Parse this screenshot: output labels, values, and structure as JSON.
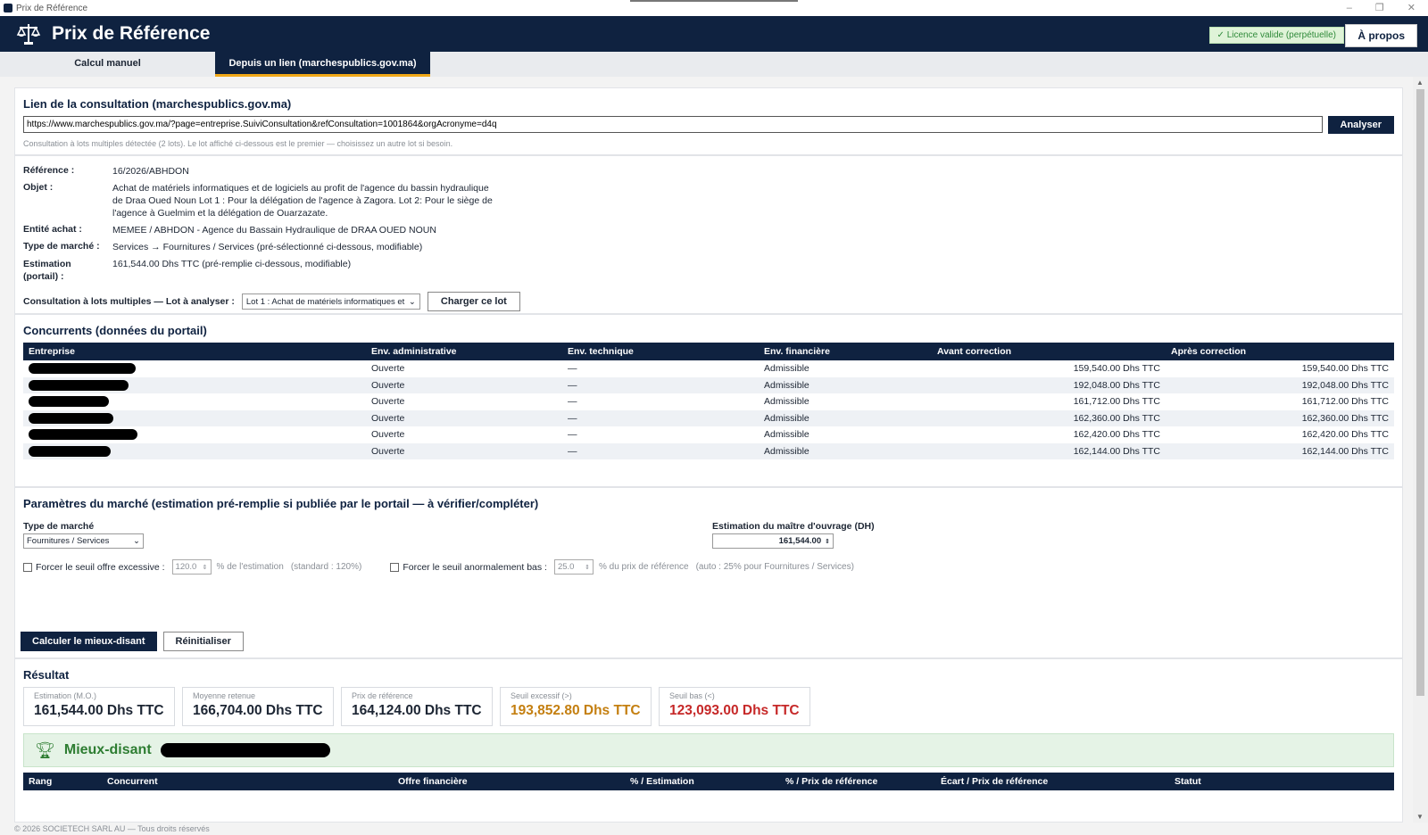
{
  "window": {
    "title": "Prix de Référence",
    "controls": [
      "–",
      "❐",
      "✕"
    ]
  },
  "header": {
    "title": "Prix de Référence",
    "licence": "✓ Licence valide (perpétuelle)",
    "apropos": "À propos"
  },
  "tabs": [
    {
      "label": "Calcul manuel"
    },
    {
      "label": "Depuis un lien (marchespublics.gov.ma)"
    }
  ],
  "link_section": {
    "title": "Lien de la consultation (marchespublics.gov.ma)",
    "url": "https://www.marchespublics.gov.ma/?page=entreprise.SuiviConsultation&refConsultation=1001864&orgAcronyme=d4q",
    "analyse_button": "Analyser",
    "hint": "Consultation à lots multiples détectée (2 lots). Le lot affiché ci-dessous est le premier — choisissez un autre lot si besoin."
  },
  "details": {
    "reference_label": "Référence :",
    "reference": "16/2026/ABHDON",
    "objet_label": "Objet :",
    "objet": "Achat de matériels informatiques et de logiciels au profit de l'agence du bassin hydraulique de Draa Oued Noun Lot 1 : Pour la délégation de l'agence à Zagora. Lot 2: Pour le siège de l'agence à Guelmim et la délégation de Ouarzazate.",
    "entite_label": "Entité achat :",
    "entite": "MEMEE / ABHDON - Agence du Bassain Hydraulique de DRAA OUED NOUN",
    "type_label": "Type de marché :",
    "type": "Services → Fournitures / Services (pré-sélectionné ci-dessous, modifiable)",
    "estimation_label": "Estimation (portail) :",
    "estimation": "161,544.00 Dhs TTC (pré-remplie ci-dessous, modifiable)",
    "lot_label": "Consultation à lots multiples — Lot à analyser :",
    "lot_value": "Lot 1 : Achat de matériels informatiques et",
    "charger_button": "Charger ce lot"
  },
  "concurrents": {
    "title": "Concurrents (données du portail)",
    "columns": [
      "Entreprise",
      "Env. administrative",
      "Env. technique",
      "Env. financière",
      "Avant correction",
      "Après correction"
    ],
    "rows": [
      {
        "admin": "Ouverte",
        "tech": "—",
        "fin": "Admissible",
        "avant": "159,540.00 Dhs TTC",
        "apres": "159,540.00 Dhs TTC"
      },
      {
        "admin": "Ouverte",
        "tech": "—",
        "fin": "Admissible",
        "avant": "192,048.00 Dhs TTC",
        "apres": "192,048.00 Dhs TTC"
      },
      {
        "admin": "Ouverte",
        "tech": "—",
        "fin": "Admissible",
        "avant": "161,712.00 Dhs TTC",
        "apres": "161,712.00 Dhs TTC"
      },
      {
        "admin": "Ouverte",
        "tech": "—",
        "fin": "Admissible",
        "avant": "162,360.00 Dhs TTC",
        "apres": "162,360.00 Dhs TTC"
      },
      {
        "admin": "Ouverte",
        "tech": "—",
        "fin": "Admissible",
        "avant": "162,420.00 Dhs TTC",
        "apres": "162,420.00 Dhs TTC"
      },
      {
        "admin": "Ouverte",
        "tech": "—",
        "fin": "Admissible",
        "avant": "162,144.00 Dhs TTC",
        "apres": "162,144.00 Dhs TTC"
      }
    ]
  },
  "parametres": {
    "title": "Paramètres du marché (estimation pré-remplie si publiée par le portail — à vérifier/compléter)",
    "type_label": "Type de marché",
    "type_value": "Fournitures / Services",
    "estimation_label": "Estimation du maître d'ouvrage (DH)",
    "estimation_value": "161,544.00",
    "seuil_excessif_label": "Forcer le seuil offre excessive :",
    "seuil_excessif_value": "120.0",
    "seuil_excessif_unit": "% de l'estimation",
    "seuil_excessif_note": "(standard : 120%)",
    "seuil_bas_label": "Forcer le seuil anormalement bas :",
    "seuil_bas_value": "25.0",
    "seuil_bas_unit": "% du prix de référence",
    "seuil_bas_note": "(auto : 25% pour Fournitures / Services)"
  },
  "actions": {
    "calculer": "Calculer le mieux-disant",
    "reinit": "Réinitialiser"
  },
  "resultat": {
    "title": "Résultat",
    "cards": [
      {
        "label": "Estimation (M.O.)",
        "value": "161,544.00 Dhs TTC"
      },
      {
        "label": "Moyenne retenue",
        "value": "166,704.00 Dhs TTC"
      },
      {
        "label": "Prix de référence",
        "value": "164,124.00 Dhs TTC"
      },
      {
        "label": "Seuil excessif (>)",
        "value": "193,852.80 Dhs TTC"
      },
      {
        "label": "Seuil bas (<)",
        "value": "123,093.00 Dhs TTC"
      }
    ],
    "mieux_label": "Mieux-disant",
    "rank_columns": [
      "Rang",
      "Concurrent",
      "Offre financière",
      "% / Estimation",
      "% / Prix de référence",
      "Écart / Prix de référence",
      "Statut"
    ]
  },
  "footer": "© 2026 SOCIETECH SARL AU — Tous droits réservés",
  "colors": {
    "navy": "#0f2240",
    "accent": "#f0a818",
    "green": "#2e7d32",
    "orange": "#c47f10",
    "red": "#c62828"
  }
}
